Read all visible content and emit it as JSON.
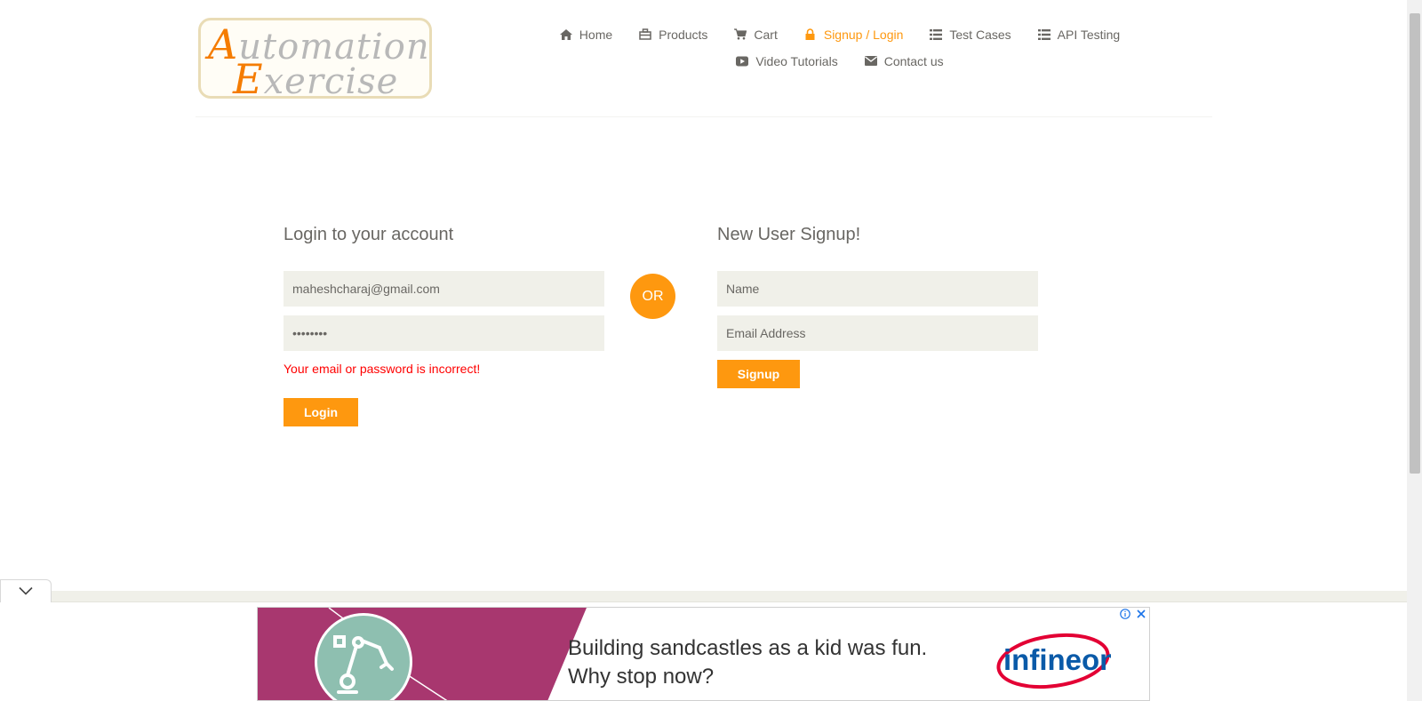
{
  "logo": {
    "line1_cap": "A",
    "line1_rest": "utomation",
    "line2_cap": "E",
    "line2_rest": "xercise",
    "accent_color": "#f57c00"
  },
  "nav": {
    "row1": [
      {
        "label": "Home",
        "icon": "home-icon"
      },
      {
        "label": "Products",
        "icon": "products-icon"
      },
      {
        "label": "Cart",
        "icon": "cart-icon"
      },
      {
        "label": "Signup / Login",
        "icon": "lock-icon",
        "active": true
      },
      {
        "label": "Test Cases",
        "icon": "list-icon"
      },
      {
        "label": "API Testing",
        "icon": "list-icon"
      }
    ],
    "row2": [
      {
        "label": "Video Tutorials",
        "icon": "youtube-icon"
      },
      {
        "label": "Contact us",
        "icon": "envelope-icon"
      }
    ],
    "active_color": "#fe980f"
  },
  "login": {
    "title": "Login to your account",
    "email_value": "maheshcharaj@gmail.com",
    "password_value": "••••••••",
    "error": "Your email or password is incorrect!",
    "button": "Login"
  },
  "divider": {
    "or": "OR"
  },
  "signup": {
    "title": "New User Signup!",
    "name_placeholder": "Name",
    "email_placeholder": "Email Address",
    "button": "Signup"
  },
  "ad": {
    "line1": "Building sandcastles as a kid was fun.",
    "line2": "Why stop now?",
    "brand": "infineon",
    "info_icon": "info-icon",
    "close_icon": "close-icon"
  },
  "colors": {
    "accent": "#fe980f",
    "field_bg": "#f0f0e9",
    "error": "#ff0000"
  }
}
